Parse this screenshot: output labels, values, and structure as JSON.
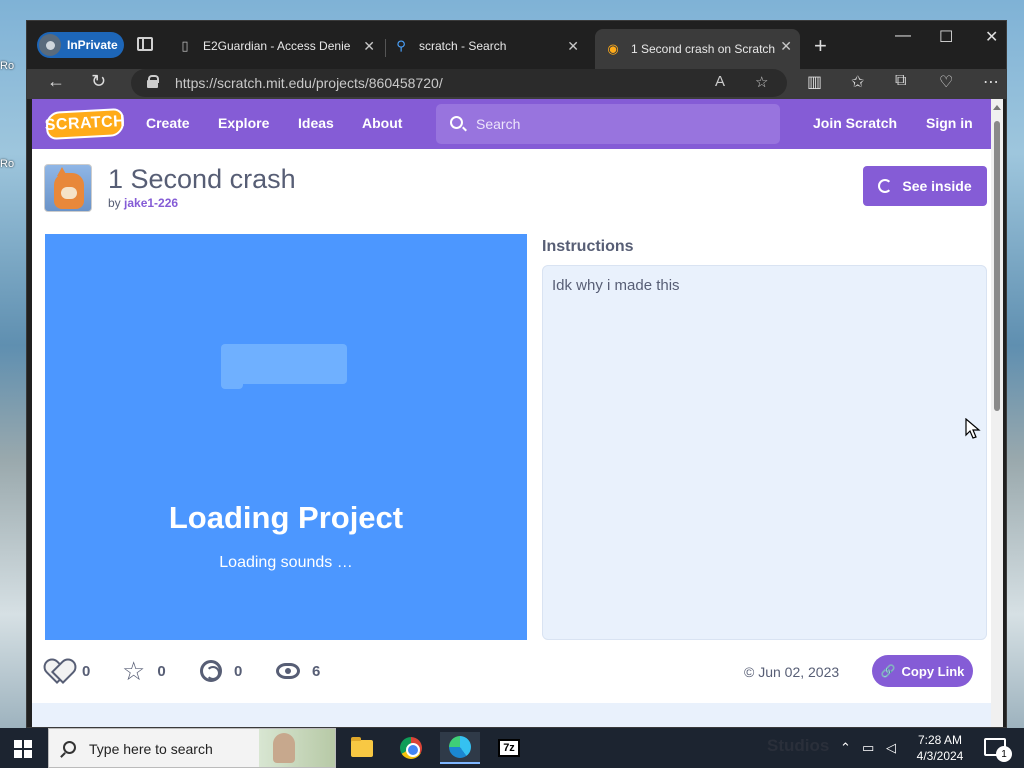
{
  "desktop": {
    "left_labels": [
      "Ro",
      "Ro"
    ]
  },
  "browser": {
    "inprivate_label": "InPrivate",
    "tabs": [
      {
        "title": "E2Guardian - Access Denie",
        "icon": "page-icon",
        "close": "✕"
      },
      {
        "title": "scratch - Search",
        "icon": "search-icon",
        "close": "✕"
      },
      {
        "title": "1 Second crash on Scratch",
        "icon": "scratch-icon",
        "close": "✕"
      }
    ],
    "new_tab_glyph": "+",
    "url": "https://scratch.mit.edu/projects/860458720/",
    "window_controls": {
      "minimize": "—",
      "maximize": "☐",
      "close": "✕"
    }
  },
  "scratch": {
    "logo": "SCRATCH",
    "nav": {
      "create": "Create",
      "explore": "Explore",
      "ideas": "Ideas",
      "about": "About",
      "search_placeholder": "Search",
      "join": "Join Scratch",
      "signin": "Sign in"
    },
    "project": {
      "title": "1 Second crash",
      "by_label": "by",
      "author": "jake1-226",
      "see_inside": "See inside",
      "loading_title": "Loading Project",
      "loading_status": "Loading sounds …",
      "instructions_heading": "Instructions",
      "instructions_text": "Idk why i made this",
      "stats": {
        "loves": "0",
        "favorites": "0",
        "remixes": "0",
        "views": "6"
      },
      "date": "© Jun 02, 2023",
      "copy_link": "Copy Link"
    },
    "colors": {
      "brand": "#855cd6",
      "stage_blue": "#4c97ff",
      "text_gray": "#575e75",
      "instructions_bg": "#e9f1fc"
    }
  },
  "taskbar": {
    "search_placeholder": "Type here to search",
    "apps": [
      "file-explorer-icon",
      "chrome-icon",
      "edge-icon",
      "7zip-icon"
    ],
    "app_7z_label": "7z",
    "studios_text": "Studios",
    "time": "7:28 AM",
    "date": "4/3/2024",
    "notification_count": "1"
  }
}
